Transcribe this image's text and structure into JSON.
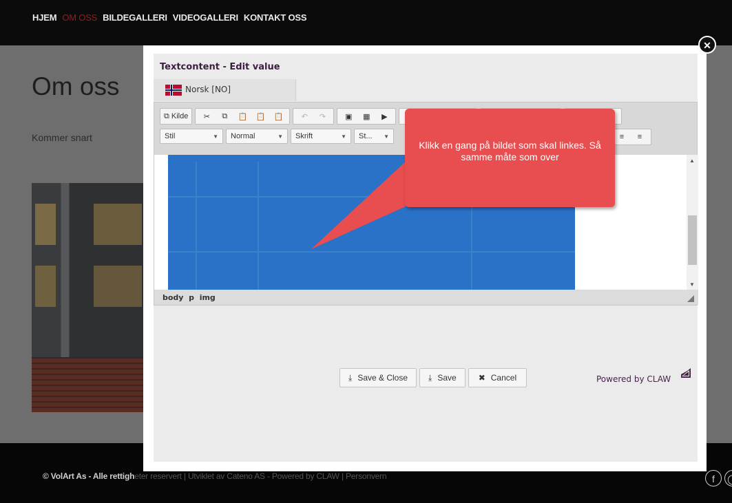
{
  "nav": {
    "items": [
      "HJEM",
      "OM OSS",
      "BILDEGALLERI",
      "VIDEOGALLERI",
      "KONTAKT OSS"
    ],
    "active": "OM OSS"
  },
  "page": {
    "title": "Om oss",
    "subtitle": "Kommer snart"
  },
  "footer": {
    "copyright": "© VolArt As - Alle rettigh",
    "credits": "eter reservert | Utviklet av Cateno AS - Powered by CLAW | Personvern"
  },
  "modal": {
    "title": "Textcontent - Edit value",
    "language_tab": "Norsk [NO]",
    "toolbar": {
      "source_label": "Kilde",
      "style_combo": "Stil",
      "format_combo": "Normal",
      "font_combo": "Skrift",
      "size_combo": "St..."
    },
    "path": [
      "body",
      "p",
      "img"
    ],
    "buttons": {
      "save_close": "Save & Close",
      "save": "Save",
      "cancel": "Cancel"
    },
    "powered_by": "Powered by CLAW"
  },
  "callout": {
    "text": "Klikk en gang på bildet som skal linkes. Så samme måte som over"
  },
  "colors": {
    "callout": "#e84d4f",
    "nav_active": "#9b1a1a",
    "image_blue": "#2a72c7"
  }
}
